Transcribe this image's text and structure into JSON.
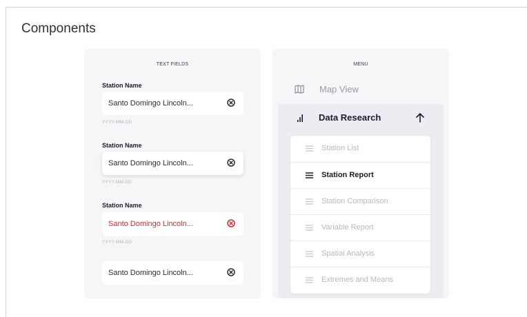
{
  "page": {
    "title": "Components"
  },
  "text_fields": {
    "heading": "TEXT FIELDS",
    "fields": [
      {
        "label": "Station Name",
        "value": "Santo Domingo Lincoln...",
        "helper": "YYYY-MM-DD",
        "state": "default"
      },
      {
        "label": "Station Name",
        "value": "Santo Domingo Lincoln...",
        "helper": "YYYY-MM-DD",
        "state": "focused"
      },
      {
        "label": "Station Name",
        "value": "Santo Domingo Lincoln...",
        "helper": "YYYY-MM-DD",
        "state": "error"
      },
      {
        "label": "",
        "value": "Santo Domingo Lincoln...",
        "helper": "",
        "state": "default"
      }
    ]
  },
  "menu": {
    "heading": "MENU",
    "map_view": {
      "label": "Map View",
      "icon": "map-icon"
    },
    "data_research": {
      "label": "Data Research",
      "icon": "bar-chart-icon",
      "toggle_icon": "arrow-up-icon",
      "expanded": true,
      "items": [
        {
          "label": "Station List",
          "active": false
        },
        {
          "label": "Station Report",
          "active": true
        },
        {
          "label": "Station Comparison",
          "active": false
        },
        {
          "label": "Variable Report",
          "active": false
        },
        {
          "label": "Spatial Analysis",
          "active": false
        },
        {
          "label": "Extremes and Means",
          "active": false
        }
      ]
    }
  },
  "colors": {
    "panel_bg": "#f6f6f8",
    "expanded_bg": "#ecedf2",
    "text_dark": "#1c1c2a",
    "text_muted": "#b8b8c2",
    "error": "#d62b2b"
  }
}
